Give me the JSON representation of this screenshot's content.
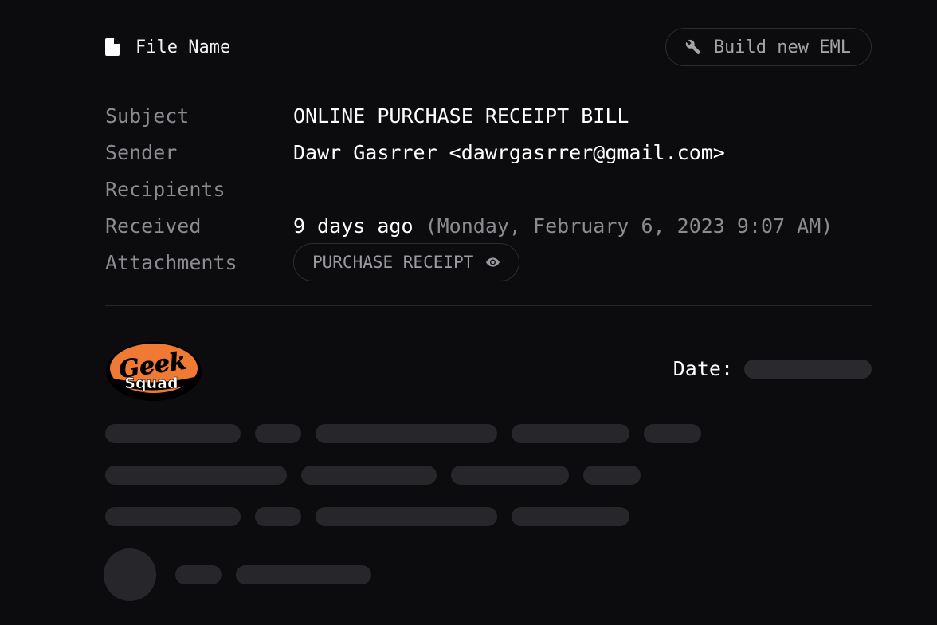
{
  "header": {
    "file_label": "File Name",
    "build_button_label": "Build new EML"
  },
  "meta": {
    "subject_label": "Subject",
    "sender_label": "Sender",
    "recipients_label": "Recipients",
    "received_label": "Received",
    "attachments_label": "Attachments",
    "subject_value": "ONLINE PURCHASE RECEIPT BILL",
    "sender_value": "Dawr Gasrrer <dawrgasrrer@gmail.com>",
    "received_relative": "9 days ago",
    "received_absolute": "(Monday, February 6, 2023 9:07 AM)",
    "attachment_name": "PURCHASE RECEIPT"
  },
  "body": {
    "logo_line1": "Geek",
    "logo_line2": "Squad",
    "date_label": "Date:"
  },
  "icons": {
    "file": "file-icon",
    "build": "wrench-icon",
    "attachment_preview": "eye-icon"
  },
  "colors": {
    "background": "#0c0c0f",
    "logo_orange": "#f07a34",
    "skeleton": "#27272b"
  }
}
